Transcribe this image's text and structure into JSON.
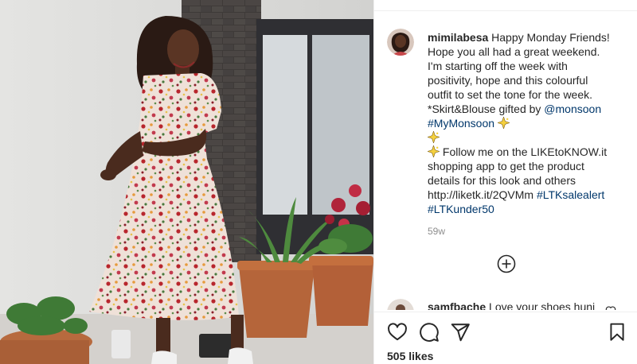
{
  "post": {
    "username": "mimilabesa",
    "caption_lines": [
      " Happy Monday Friends!",
      "Hope you all had a great weekend.",
      "I'm starting off the week with",
      "positivity, hope and this colourful",
      "outfit to set the tone for the week.",
      "*Skirt&Blouse gifted by "
    ],
    "mention": "@monsoon",
    "hashtag_mymonsoon": "#MyMonsoon",
    "follow_line_1": " Follow me on the LIKEtoKNOW.it",
    "follow_line_2": "shopping app to get the product",
    "follow_line_3": "details for this look and others",
    "link_text": "http://liketk.it/2QVMm ",
    "hashtag_ltksalealert": "#LTKsalealert",
    "hashtag_ltkunder50": "#LTKunder50",
    "time_ago": "59w"
  },
  "comment": {
    "username": "samfbache",
    "text": " Love your shoes huni"
  },
  "likes": "505 likes",
  "icons": {
    "sparkle": "sparkle-icon",
    "load_more": "plus-circle-icon",
    "like": "heart-icon",
    "comment": "comment-icon",
    "share": "paper-plane-icon",
    "save": "bookmark-icon"
  },
  "colors": {
    "hashtag": "#00376b",
    "text": "#262626",
    "muted": "#8e8e8e",
    "sparkle": "#f4d03f"
  }
}
